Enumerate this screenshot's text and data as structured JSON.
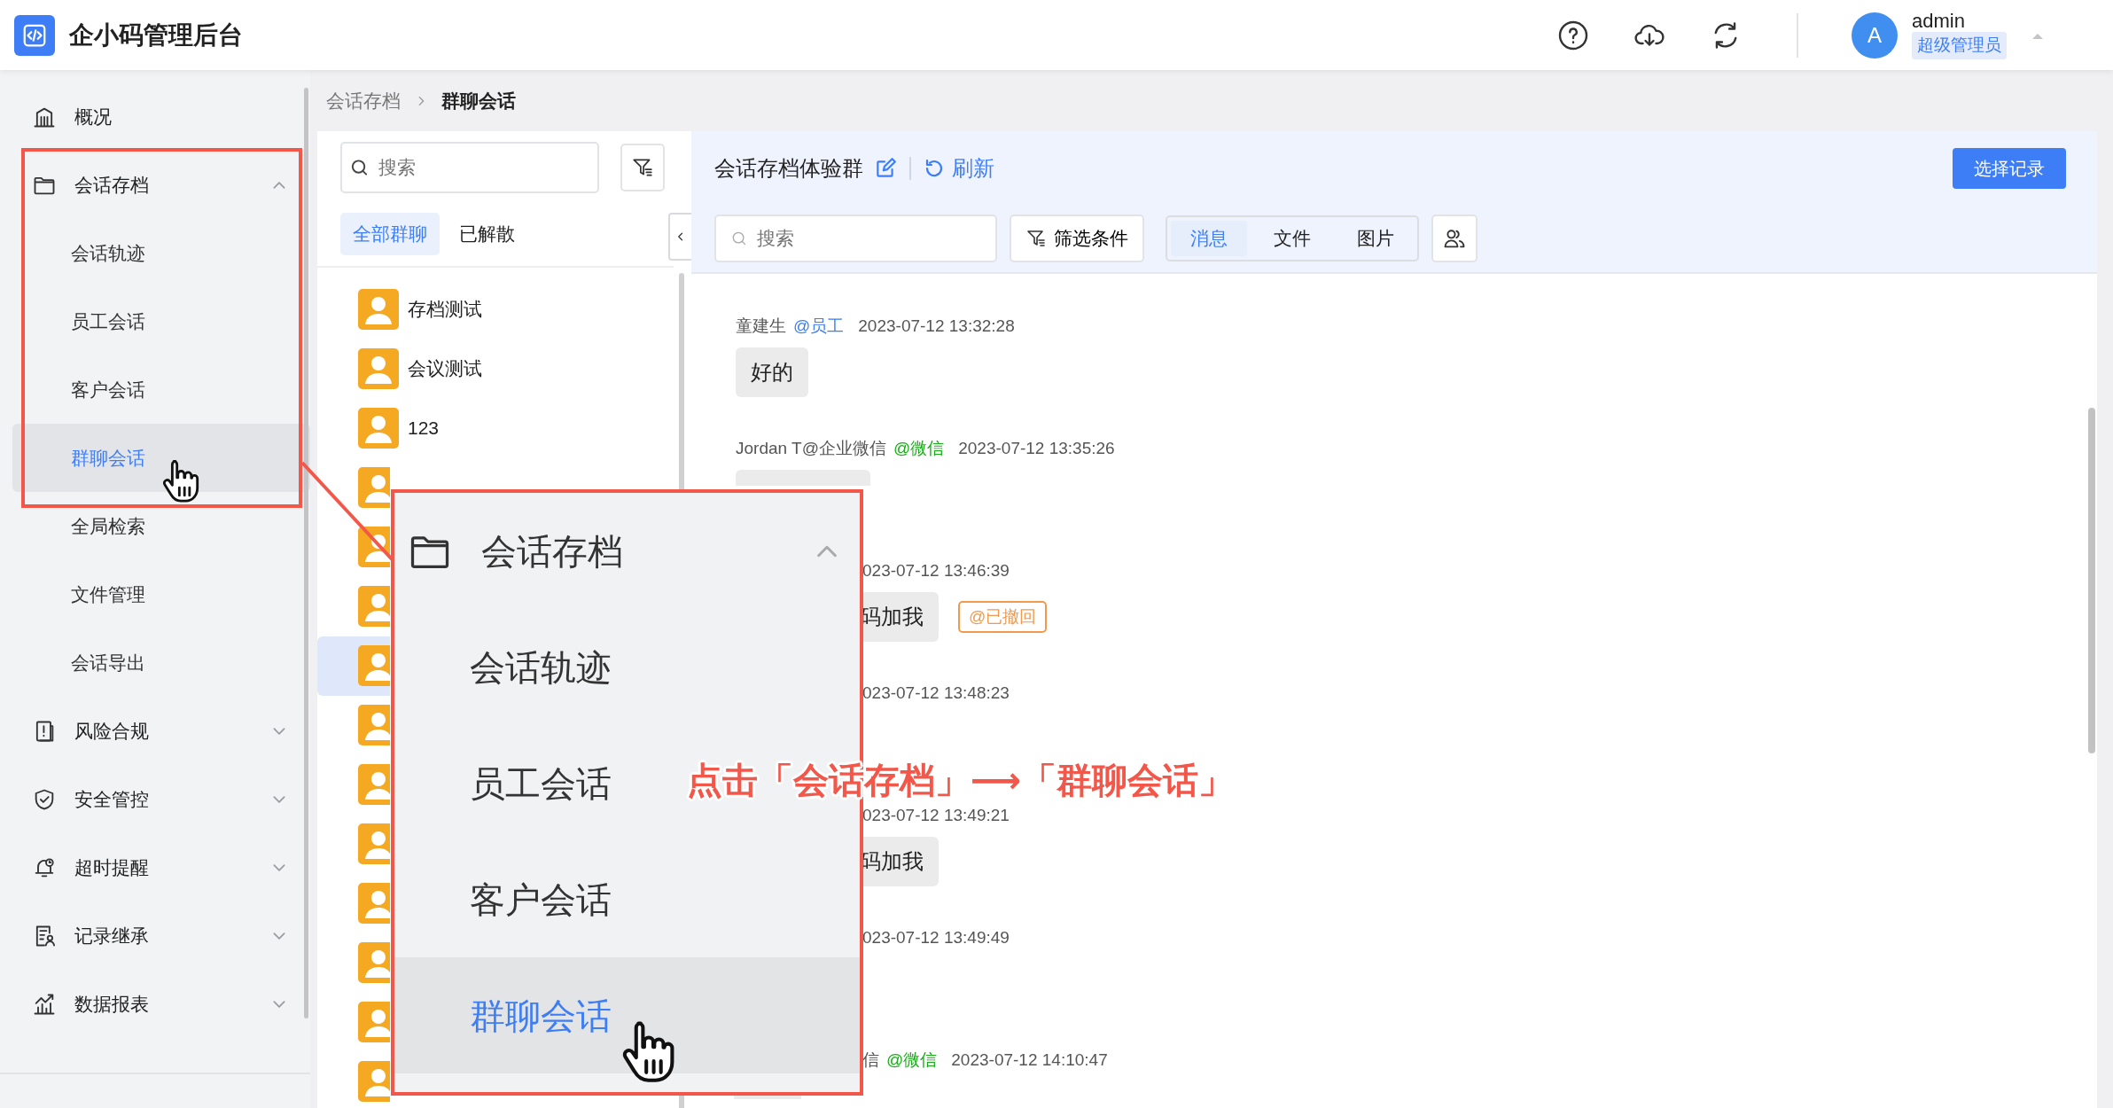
{
  "header": {
    "title": "企小码管理后台",
    "user": {
      "avatar": "A",
      "name": "admin",
      "role": "超级管理员"
    }
  },
  "sidebar": {
    "items": [
      {
        "label": "概况"
      },
      {
        "label": "会话存档",
        "expanded": true,
        "children": [
          {
            "label": "会话轨迹",
            "selected": false
          },
          {
            "label": "员工会话",
            "selected": false
          },
          {
            "label": "客户会话",
            "selected": false
          },
          {
            "label": "群聊会话",
            "selected": true
          },
          {
            "label": "全局检索",
            "selected": false
          },
          {
            "label": "文件管理",
            "selected": false
          },
          {
            "label": "会话导出",
            "selected": false
          }
        ]
      },
      {
        "label": "风险合规",
        "expanded": false
      },
      {
        "label": "安全管控",
        "expanded": false
      },
      {
        "label": "超时提醒",
        "expanded": false
      },
      {
        "label": "记录继承",
        "expanded": false
      },
      {
        "label": "数据报表",
        "expanded": false
      }
    ]
  },
  "breadcrumb": [
    {
      "label": "会话存档",
      "current": false
    },
    {
      "label": "群聊会话",
      "current": true
    }
  ],
  "group_panel": {
    "search": {
      "placeholder": "搜索"
    },
    "tabs": [
      {
        "label": "全部群聊",
        "selected": true
      },
      {
        "label": "已解散",
        "selected": false
      }
    ],
    "groups": [
      {
        "name": "存档测试",
        "selected": false
      },
      {
        "name": "会议测试",
        "selected": false
      },
      {
        "name": "123",
        "selected": false
      },
      {
        "selected": false
      },
      {
        "selected": false
      },
      {
        "selected": false
      },
      {
        "selected": true
      },
      {
        "selected": false
      },
      {
        "selected": false
      },
      {
        "selected": false
      },
      {
        "selected": false
      },
      {
        "selected": false
      },
      {
        "selected": false
      },
      {
        "selected": false
      }
    ]
  },
  "chat": {
    "title": "会话存档体验群",
    "refresh": "刷新",
    "select_button": "选择记录",
    "search": {
      "placeholder": "搜索"
    },
    "filter_button": "筛选条件",
    "view_tabs": [
      {
        "label": "消息",
        "selected": true
      },
      {
        "label": "文件",
        "selected": false
      },
      {
        "label": "图片",
        "selected": false
      }
    ],
    "messages": [
      {
        "kind": "full",
        "sender": "童建生",
        "tag": {
          "label": "@员工",
          "color": "#3d7ef6"
        },
        "time": "2023-07-12 13:32:28",
        "text": "好的"
      },
      {
        "kind": "covered",
        "sender": "Jordan T@企业微信",
        "tag": {
          "label": "@微信",
          "color": "#1aad19"
        },
        "time": "2023-07-12 13:35:26"
      },
      {
        "kind": "partial",
        "time": "023-07-12 13:46:39",
        "text": "码加我",
        "recalled": "@已撤回"
      },
      {
        "kind": "partial",
        "time": "023-07-12 13:48:23"
      },
      {
        "kind": "partial",
        "time": "023-07-12 13:49:21",
        "text": "码加我"
      },
      {
        "kind": "partial",
        "time": "023-07-12 13:49:49"
      },
      {
        "kind": "tail",
        "sender": "信",
        "tag": {
          "label": "@微信",
          "color": "#1aad19"
        },
        "time": "2023-07-12 14:10:47"
      }
    ]
  },
  "annotation": {
    "menu": {
      "label": "会话存档",
      "expanded": true,
      "items": [
        {
          "label": "会话轨迹",
          "selected": false
        },
        {
          "label": "员工会话",
          "selected": false
        },
        {
          "label": "客户会话",
          "selected": false
        },
        {
          "label": "群聊会话",
          "selected": true
        }
      ]
    },
    "caption": "点击「会话存档」⟶「群聊会话」"
  }
}
